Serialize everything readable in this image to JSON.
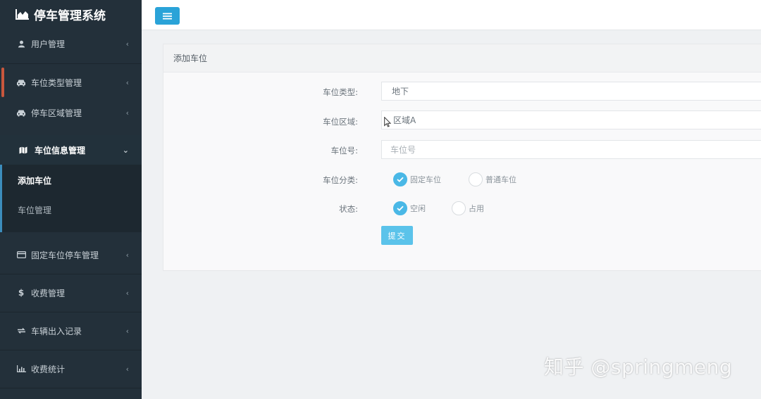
{
  "app": {
    "title": "停车管理系统"
  },
  "sidebar": {
    "items": [
      {
        "label": "用户管理",
        "icon": "user-icon"
      },
      {
        "label": "车位类型管理",
        "icon": "car-icon"
      },
      {
        "label": "停车区域管理",
        "icon": "car-icon"
      },
      {
        "label": "车位信息管理",
        "icon": "map-icon",
        "expanded": true,
        "children": [
          {
            "label": "添加车位",
            "active": true
          },
          {
            "label": "车位管理"
          }
        ]
      },
      {
        "label": "固定车位停车管理",
        "icon": "credit-card-icon"
      },
      {
        "label": "收费管理",
        "icon": "dollar-icon"
      },
      {
        "label": "车辆出入记录",
        "icon": "exchange-icon"
      },
      {
        "label": "收费统计",
        "icon": "bar-chart-icon"
      }
    ]
  },
  "panel": {
    "title": "添加车位",
    "fields": {
      "type_label": "车位类型:",
      "type_value": "地下",
      "area_label": "车位区域:",
      "area_value": "区域A",
      "number_label": "车位号:",
      "number_placeholder": "车位号",
      "category_label": "车位分类:",
      "category_options": [
        {
          "label": "固定车位",
          "checked": true
        },
        {
          "label": "普通车位",
          "checked": false
        }
      ],
      "status_label": "状态:",
      "status_options": [
        {
          "label": "空闲",
          "checked": true
        },
        {
          "label": "占用",
          "checked": false
        }
      ]
    },
    "submit_label": "提交"
  },
  "watermark": "知乎 @springmeng",
  "colors": {
    "sidebar_bg": "#23303a",
    "accent": "#2aa3d8",
    "radio_on": "#4ab8e6",
    "submit": "#5bc3ea"
  }
}
